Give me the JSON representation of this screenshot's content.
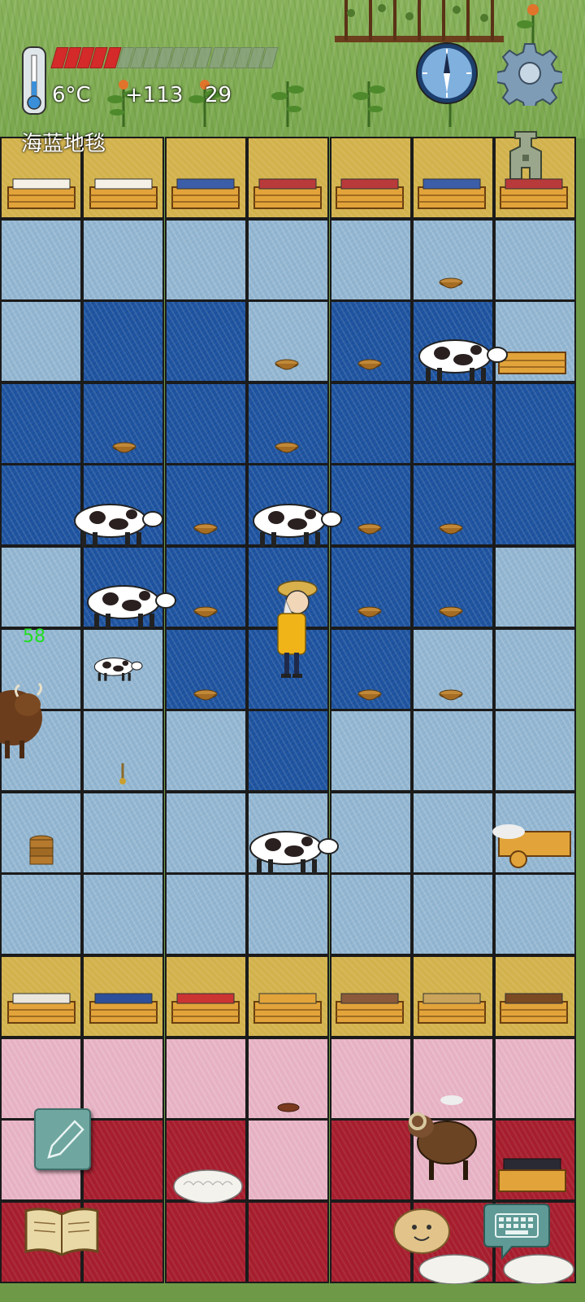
{
  "hud": {
    "temperature": "6°C",
    "yum_bonus": "+113",
    "yum_chain": "29",
    "current_tile": "海蓝地毯",
    "player_age": "58",
    "heat_bar": {
      "filled_segments": 5,
      "total_segments": 17,
      "fill_color": "#d42a2a",
      "empty_color": "#8a9f86"
    }
  },
  "colors": {
    "yellow_floor": "#d2b24c",
    "light_rug": "#8fb3cf",
    "navy_rug": "#1f55a2",
    "pink_rug": "#e6b1c3",
    "red_rug": "#a61e2e",
    "grass": "#7aa84e",
    "age_text": "#22dd22"
  },
  "icons": {
    "thermometer": "thermometer-icon",
    "heat_food": "hunger-bar",
    "compass": "compass-icon",
    "settings": "gear-icon",
    "coin": "spade-coin-icon",
    "pencil": "pencil-icon",
    "book": "recipe-book-icon",
    "emote": "emote-face-icon",
    "keyboard": "keyboard-icon"
  },
  "map": {
    "rows": [
      [
        "yellow",
        "yellow",
        "yellow",
        "yellow",
        "yellow",
        "yellow",
        "yellow"
      ],
      [
        "light",
        "light",
        "light",
        "light",
        "light",
        "light",
        "light"
      ],
      [
        "light",
        "dark",
        "dark",
        "light",
        "dark",
        "dark",
        "light"
      ],
      [
        "dark",
        "dark",
        "dark",
        "dark",
        "dark",
        "dark",
        "dark"
      ],
      [
        "dark",
        "dark",
        "dark",
        "dark",
        "dark",
        "dark",
        "dark"
      ],
      [
        "light",
        "dark",
        "dark",
        "dark",
        "dark",
        "dark",
        "light"
      ],
      [
        "light",
        "light",
        "dark",
        "dark",
        "dark",
        "light",
        "light"
      ],
      [
        "light",
        "light",
        "light",
        "dark",
        "light",
        "light",
        "light"
      ],
      [
        "light",
        "light",
        "light",
        "light",
        "light",
        "light",
        "light"
      ],
      [
        "light",
        "light",
        "light",
        "light",
        "light",
        "light",
        "light"
      ],
      [
        "yellow",
        "yellow",
        "yellow",
        "yellow",
        "yellow",
        "yellow",
        "yellow"
      ],
      [
        "pink",
        "pink",
        "pink",
        "pink",
        "pink",
        "pink",
        "pink"
      ],
      [
        "pink",
        "red",
        "red",
        "pink",
        "red",
        "pink",
        "red"
      ],
      [
        "red",
        "red",
        "red",
        "red",
        "red",
        "red",
        "red"
      ]
    ]
  }
}
